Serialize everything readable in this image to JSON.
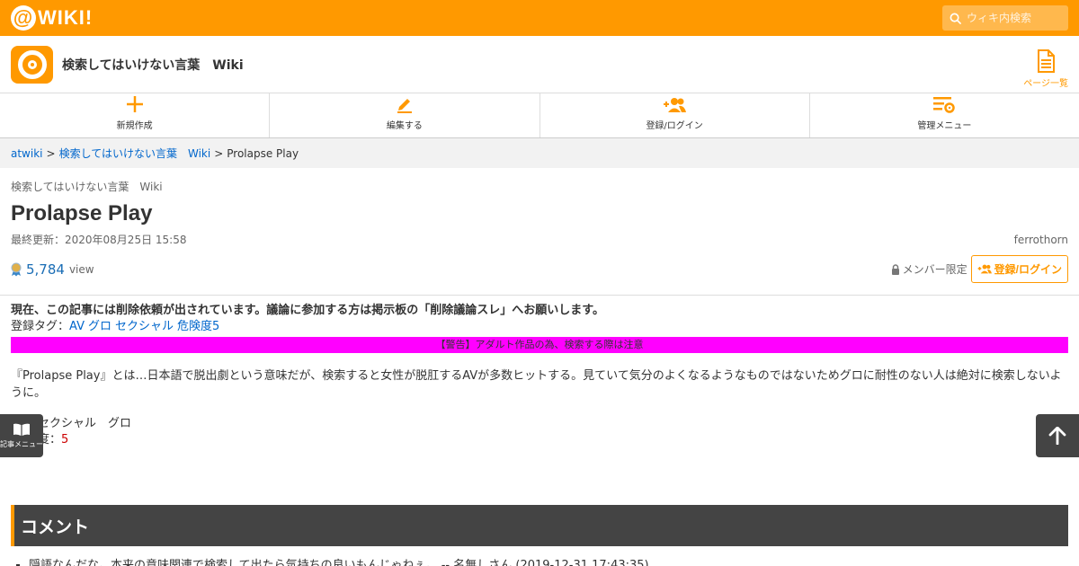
{
  "topbar": {
    "brand": "WIKI!",
    "search_placeholder": "ウィキ内検索"
  },
  "site": {
    "title": "検索してはいけない言葉　Wiki",
    "page_list_label": "ページ一覧"
  },
  "toolbar": {
    "new": "新規作成",
    "edit": "編集する",
    "login": "登録/ログイン",
    "admin": "管理メニュー"
  },
  "breadcrumb": {
    "root": "atwiki",
    "sep": ">",
    "wiki": "検索してはいけない言葉　Wiki",
    "current": "Prolapse Play"
  },
  "page": {
    "subtitle": "検索してはいけない言葉　Wiki",
    "title": "Prolapse Play",
    "updated": "最終更新：2020年08月25日 15:58",
    "author": "ferrothorn",
    "views": "5,784",
    "views_label": "view",
    "member_only": "メンバー限定",
    "login_button": "登録/ログイン"
  },
  "content": {
    "notice": "現在、この記事には削除依頼が出されています。議論に参加する方は掲示板の「削除議論スレ」へお願いします。",
    "tags_label": "登録タグ：",
    "tags": [
      "AV",
      "グロ",
      "セクシャル",
      "危険度5"
    ],
    "warning": "【警告】アダルト作品の為、検索する際は注意",
    "paragraph": "『Prolapse Play』とは…日本語で脱出劇という意味だが、検索すると女性が脱肛するAVが多数ヒットする。見ていて気分のよくなるようなものではないためグロに耐性のない人は絶対に検索しないように。",
    "categories": "セクシャル　グロ",
    "danger_label": "度：",
    "danger_value": "5"
  },
  "floating": {
    "article_menu": "記事メニュー"
  },
  "comments": {
    "heading": "コメント",
    "items": [
      "隠語なんだな。本来の意味関連で検索して出たら気持ちの良いもんじゃねぇ。 -- 名無しさん (2019-12-31 17:43:35)"
    ]
  },
  "colors": {
    "brand": "#ff9900",
    "link": "#0066cc",
    "warning_bg": "#ff00ff",
    "dark": "#444444"
  }
}
